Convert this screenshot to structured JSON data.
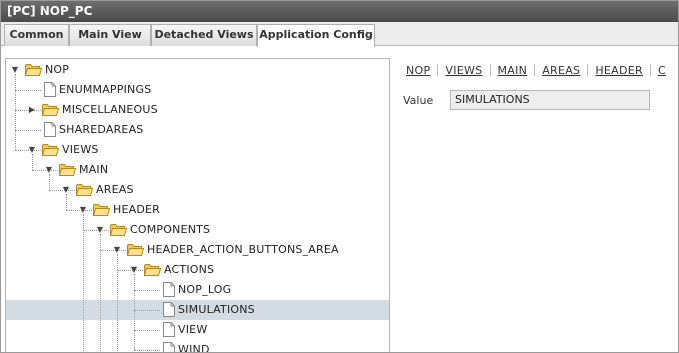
{
  "window": {
    "title": "[PC] NOP_PC"
  },
  "tabs": [
    {
      "label": "Common",
      "active": false
    },
    {
      "label": "Main View",
      "active": false
    },
    {
      "label": "Detached Views",
      "active": false
    },
    {
      "label": "Application Config",
      "active": true
    }
  ],
  "tree": {
    "nodes": [
      {
        "label": "NOP",
        "type": "folder",
        "expanded": true
      },
      {
        "label": "ENUMMAPPINGS",
        "type": "file"
      },
      {
        "label": "MISCELLANEOUS",
        "type": "folder",
        "expanded": false
      },
      {
        "label": "SHAREDAREAS",
        "type": "file"
      },
      {
        "label": "VIEWS",
        "type": "folder",
        "expanded": true
      },
      {
        "label": "MAIN",
        "type": "folder",
        "expanded": true
      },
      {
        "label": "AREAS",
        "type": "folder",
        "expanded": true
      },
      {
        "label": "HEADER",
        "type": "folder",
        "expanded": true
      },
      {
        "label": "COMPONENTS",
        "type": "folder",
        "expanded": true
      },
      {
        "label": "HEADER_ACTION_BUTTONS_AREA",
        "type": "folder",
        "expanded": true
      },
      {
        "label": "ACTIONS",
        "type": "folder",
        "expanded": true
      },
      {
        "label": "NOP_LOG",
        "type": "file"
      },
      {
        "label": "SIMULATIONS",
        "type": "file",
        "selected": true
      },
      {
        "label": "VIEW",
        "type": "file"
      },
      {
        "label": "WIND",
        "type": "file"
      }
    ]
  },
  "breadcrumb": [
    "NOP",
    "VIEWS",
    "MAIN",
    "AREAS",
    "HEADER",
    "C"
  ],
  "detail": {
    "value_label": "Value",
    "value": "SIMULATIONS"
  }
}
